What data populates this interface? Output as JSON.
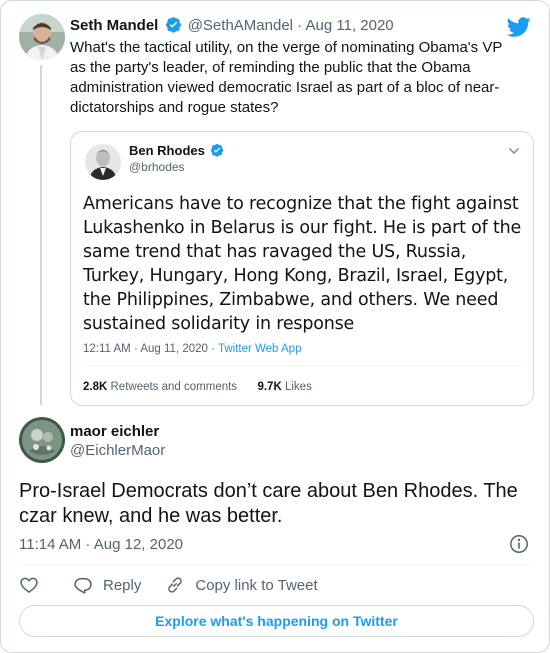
{
  "parent_tweet": {
    "author_name": "Seth Mandel",
    "handle": "@SethAMandel",
    "date": "Aug 11, 2020",
    "text": "What's the tactical utility, on the verge of nominating Obama's VP as the party's leader, of reminding the public that the Obama administration viewed democratic Israel as part of a bloc of near-dictatorships and rogue states?"
  },
  "quoted_tweet": {
    "author_name": "Ben Rhodes",
    "handle": "@brhodes",
    "text": "Americans have to recognize that the fight against Lukashenko in Belarus is our fight. He is part of the same trend that has ravaged the US, Russia, Turkey, Hungary, Hong Kong, Brazil, Israel, Egypt, the Philippines, Zimbabwe, and others. We need sustained solidarity in response",
    "time": "12:11 AM",
    "date": "Aug 11, 2020",
    "source": "Twitter Web App",
    "retweets_count": "2.8K",
    "retweets_label": "Retweets and comments",
    "likes_count": "9.7K",
    "likes_label": "Likes"
  },
  "reply_tweet": {
    "author_name": "maor eichler",
    "handle": "@EichlerMaor",
    "text": "Pro-Israel Democrats don’t care about Ben Rhodes. The czar knew, and he was better.",
    "timestamp": "11:14 AM · Aug 12, 2020"
  },
  "actions": {
    "reply_label": "Reply",
    "copy_link_label": "Copy link to Tweet"
  },
  "explore_button": "Explore what's happening on Twitter",
  "colors": {
    "accent": "#1d9bf0",
    "text_primary": "#0f1419",
    "text_secondary": "#536471",
    "border": "#cfd9de"
  },
  "icons": [
    "twitter-bird-icon",
    "verified-badge-icon",
    "chevron-down-icon",
    "info-icon",
    "heart-icon",
    "reply-icon",
    "link-icon"
  ]
}
